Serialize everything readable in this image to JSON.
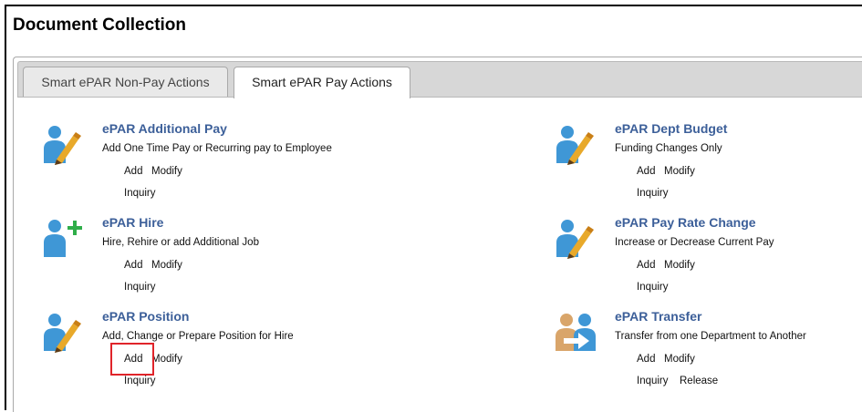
{
  "page_title": "Document Collection",
  "tabs": [
    {
      "label": "Smart ePAR Non-Pay Actions",
      "selected": false
    },
    {
      "label": "Smart ePAR Pay Actions",
      "selected": true
    }
  ],
  "colors": {
    "title_link": "#3c5f99",
    "icon_person": "#3f97d6",
    "icon_pen": "#e8a92a",
    "plus": "#2fae49",
    "highlight": "#e0242a"
  },
  "actions": {
    "additional_pay": {
      "icon": "person-pen-icon",
      "title": "ePAR Additional Pay",
      "description": "Add One Time Pay or Recurring pay to Employee",
      "add": "Add",
      "modify": "Modify",
      "inquiry": "Inquiry"
    },
    "hire": {
      "icon": "person-plus-icon",
      "title": "ePAR Hire",
      "description": "Hire, Rehire or add Additional Job",
      "add": "Add",
      "modify": "Modify",
      "inquiry": "Inquiry"
    },
    "position": {
      "icon": "person-pen-icon",
      "title": "ePAR Position",
      "description": "Add, Change or Prepare Position for Hire",
      "add": "Add",
      "modify": "Modify",
      "inquiry": "Inquiry"
    },
    "dept_budget": {
      "icon": "person-pen-icon",
      "title": "ePAR Dept Budget",
      "description": "Funding Changes Only",
      "add": "Add",
      "modify": "Modify",
      "inquiry": "Inquiry"
    },
    "pay_rate_change": {
      "icon": "person-pen-icon",
      "title": "ePAR Pay Rate Change",
      "description": "Increase or Decrease Current Pay",
      "add": "Add",
      "modify": "Modify",
      "inquiry": "Inquiry"
    },
    "transfer": {
      "icon": "transfer-icon",
      "title": "ePAR Transfer",
      "description": "Transfer from one Department to Another",
      "add": "Add",
      "modify": "Modify",
      "inquiry": "Inquiry",
      "release": "Release"
    }
  }
}
